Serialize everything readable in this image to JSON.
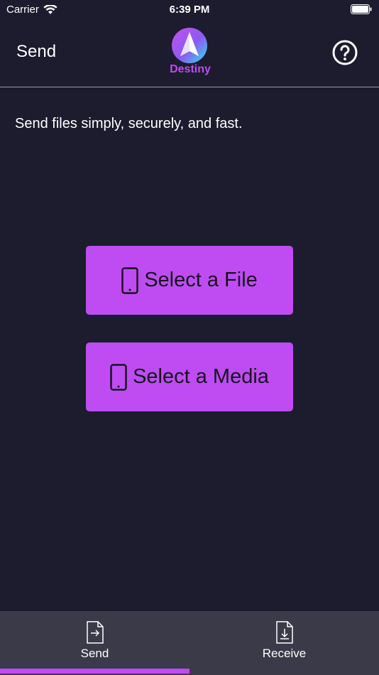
{
  "status_bar": {
    "carrier": "Carrier",
    "time": "6:39 PM"
  },
  "header": {
    "title": "Send",
    "logo_text": "Destiny",
    "help_icon": "question-circle-icon"
  },
  "main": {
    "subtitle": "Send files simply, securely, and fast.",
    "select_file_label": "Select a File",
    "select_media_label": "Select a Media",
    "button_icon": "phone-icon"
  },
  "tabs": [
    {
      "label": "Send",
      "icon": "send-file-icon",
      "selected": true
    },
    {
      "label": "Receive",
      "icon": "receive-file-icon",
      "selected": false
    }
  ],
  "colors": {
    "background": "#1c1c2e",
    "accent": "#bf4cf2",
    "tab_bar": "#3a3a48"
  }
}
